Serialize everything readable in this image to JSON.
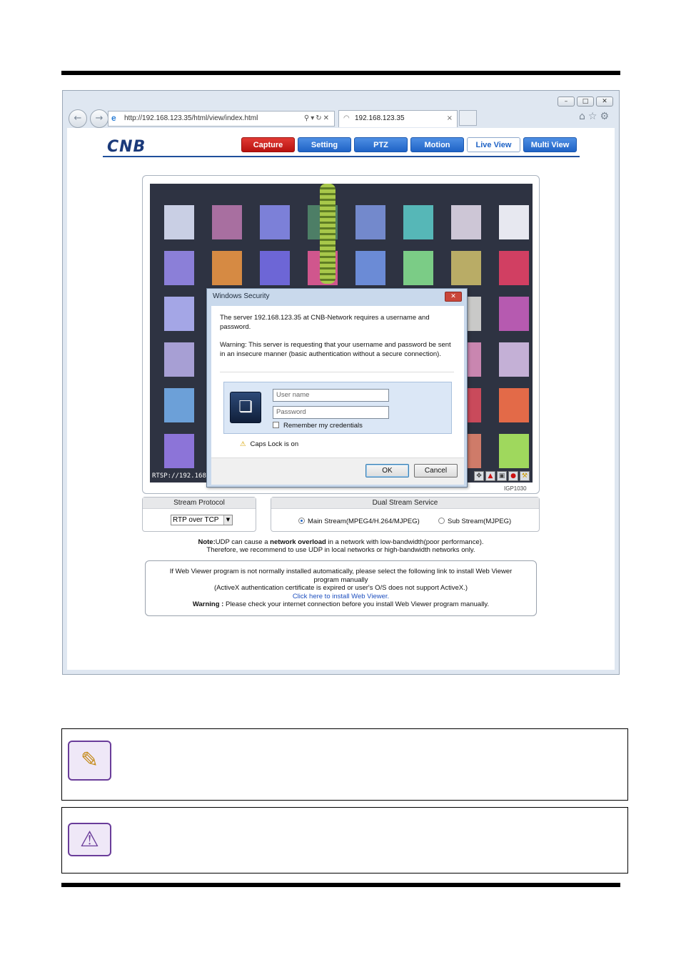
{
  "browser": {
    "address": "http://192.168.123.35/html/view/index.html",
    "tab_title": "192.168.123.35",
    "window_controls": [
      "–",
      "□",
      "✕"
    ]
  },
  "header": {
    "logo": "CNB",
    "menu": [
      {
        "label": "Capture",
        "style": "red"
      },
      {
        "label": "Setting",
        "style": "blue"
      },
      {
        "label": "PTZ",
        "style": "blue"
      },
      {
        "label": "Motion",
        "style": "blue"
      },
      {
        "label": "Live View",
        "style": "active"
      },
      {
        "label": "Multi View",
        "style": "blue"
      }
    ]
  },
  "video": {
    "rtsp_label": "RTSP://192.168.",
    "model": "IGP1030",
    "tile_colors": [
      [
        "#c9cfe4",
        "#a86fa0",
        "#7c80d8",
        "#4d7e66",
        "#7389cc",
        "#56b7b7",
        "#cdc6d6",
        "#e7e8f0"
      ],
      [
        "#8b7fd8",
        "#d68a43",
        "#6d66d6",
        "#d0568d",
        "#6b8bd6",
        "#7bcc86",
        "#b9ac66",
        "#d13f62"
      ],
      [
        "#a4a6e6",
        "#bba070",
        "#8c7fd0",
        "#9ec3d8",
        "#aab0b8",
        "#9fd0b6",
        "#c9c9c8",
        "#b65ab0"
      ],
      [
        "#a79fd4",
        "#b89cb8",
        "#7e8ad5",
        "#c58a85",
        "#6d6bc7",
        "#c86cb4",
        "#c986b0",
        "#c4b0d6"
      ],
      [
        "#6ca0d8",
        "#8bd27e",
        "#67a4d6",
        "#5eb9c9",
        "#d8a65b",
        "#d0d84e",
        "#c94a5b",
        "#e36a48"
      ],
      [
        "#8c74d8",
        "#d2918e",
        "#5f5ad4",
        "#e1a545",
        "#7cb6b0",
        "#a67fd8",
        "#cf7b69",
        "#9fd85d"
      ]
    ]
  },
  "dialog": {
    "title": "Windows Security",
    "message1": "The server 192.168.123.35 at CNB-Network requires a username and password.",
    "message2": "Warning: This server is requesting that your username and password be sent in an insecure manner (basic authentication without a secure connection).",
    "username_placeholder": "User name",
    "password_placeholder": "Password",
    "remember_label": "Remember my credentials",
    "caps_lock": "Caps Lock is on",
    "ok_label": "OK",
    "cancel_label": "Cancel"
  },
  "stream_protocol": {
    "title": "Stream Protocol",
    "selected": "RTP over TCP"
  },
  "dual_stream": {
    "title": "Dual Stream Service",
    "main_label": "Main Stream(MPEG4/H.264/MJPEG)",
    "sub_label": "Sub Stream(MJPEG)",
    "main_selected": true
  },
  "note": {
    "prefix": "Note:",
    "text1": "UDP can cause a ",
    "bold": "network overload",
    "text2": " in a network with low-bandwidth(poor performance).",
    "line2": "Therefore, we recommend to use UDP in local networks or high-bandwidth networks only."
  },
  "install": {
    "line1": "If Web Viewer program is not normally installed automatically, please select the following link to install Web Viewer",
    "line2": "program manually",
    "line3": "(ActiveX authentication certificate is expired or user's O/S does not support ActiveX.)",
    "link": "Click here to install Web Viewer.",
    "warning_label": "Warning :",
    "warning_text": " Please check your internet connection before you install Web Viewer program manually."
  },
  "icons": {
    "note": "pencil-note-icon",
    "caution": "warning-triangle-icon"
  }
}
